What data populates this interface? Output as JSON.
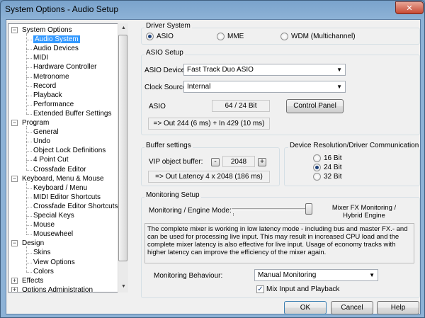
{
  "window": {
    "title": "System Options - Audio Setup"
  },
  "titlebar_buttons": {
    "minimize": "–",
    "maximize": "□",
    "close": "✕"
  },
  "tree": [
    {
      "label": "System Options",
      "level": 0,
      "expander": "−"
    },
    {
      "label": "Audio System",
      "level": 1,
      "selected": true
    },
    {
      "label": "Audio Devices",
      "level": 1
    },
    {
      "label": "MIDI",
      "level": 1
    },
    {
      "label": "Hardware Controller",
      "level": 1
    },
    {
      "label": "Metronome",
      "level": 1
    },
    {
      "label": "Record",
      "level": 1
    },
    {
      "label": "Playback",
      "level": 1
    },
    {
      "label": "Performance",
      "level": 1
    },
    {
      "label": "Extended Buffer Settings",
      "level": 1
    },
    {
      "label": "Program",
      "level": 0,
      "expander": "−"
    },
    {
      "label": "General",
      "level": 1
    },
    {
      "label": "Undo",
      "level": 1
    },
    {
      "label": "Object Lock Definitions",
      "level": 1
    },
    {
      "label": "4 Point Cut",
      "level": 1
    },
    {
      "label": "Crossfade Editor",
      "level": 1
    },
    {
      "label": "Keyboard, Menu & Mouse",
      "level": 0,
      "expander": "−"
    },
    {
      "label": "Keyboard / Menu",
      "level": 1
    },
    {
      "label": "MIDI Editor Shortcuts",
      "level": 1
    },
    {
      "label": "Crossfade Editor Shortcuts",
      "level": 1
    },
    {
      "label": "Special Keys",
      "level": 1
    },
    {
      "label": "Mouse",
      "level": 1
    },
    {
      "label": "Mousewheel",
      "level": 1
    },
    {
      "label": "Design",
      "level": 0,
      "expander": "−"
    },
    {
      "label": "Skins",
      "level": 1
    },
    {
      "label": "View Options",
      "level": 1
    },
    {
      "label": "Colors",
      "level": 1
    },
    {
      "label": "Effects",
      "level": 0,
      "expander": "+"
    },
    {
      "label": "Options Administration",
      "level": 0,
      "expander": "+"
    }
  ],
  "driver_system": {
    "title": "Driver System",
    "options": [
      "ASIO",
      "MME",
      "WDM (Multichannel)"
    ],
    "selected": "ASIO"
  },
  "asio_setup": {
    "title": "ASIO Setup",
    "device_label": "ASIO Device:",
    "device_value": "Fast Track Duo ASIO",
    "clock_label": "Clock Source:",
    "clock_value": "Internal",
    "asio_label": "ASIO",
    "format_value": "64 / 24 Bit",
    "control_panel_label": "Control Panel",
    "latency_text": "=> Out 244 (6 ms) + In 429 (10 ms)"
  },
  "buffer_settings": {
    "title": "Buffer settings",
    "vip_label": "VIP object buffer:",
    "minus_label": "-",
    "plus_label": "+",
    "value": "2048",
    "latency_text": "=> Out Latency 4 x 2048 (186 ms)"
  },
  "device_resolution": {
    "title": "Device Resolution/Driver Communication",
    "options": [
      "16 Bit",
      "24 Bit",
      "32 Bit"
    ],
    "selected": "24 Bit"
  },
  "monitoring": {
    "title": "Monitoring Setup",
    "mode_label": "Monitoring / Engine Mode:",
    "mode_value_line1": "Mixer FX Monitoring /",
    "mode_value_line2": "Hybrid Engine",
    "slider_level": 1.0,
    "description": "The complete mixer is working in low latency mode - including bus and master FX.- and can be used for processing live input.  This may result in increased CPU load and the complete mixer latency is also effective for live input. Usage of economy tracks with higher latency can improve the efficiency of the mixer again.",
    "behaviour_label": "Monitoring Behaviour:",
    "behaviour_value": "Manual Monitoring",
    "mix_input_label": "Mix Input and Playback",
    "mix_input_checked": true
  },
  "footer": {
    "ok": "OK",
    "cancel": "Cancel",
    "help": "Help"
  },
  "colors": {
    "selection": "#3399ff",
    "title_gradient": "#7aa3cc",
    "dialog_bg": "#f0f0f0"
  }
}
